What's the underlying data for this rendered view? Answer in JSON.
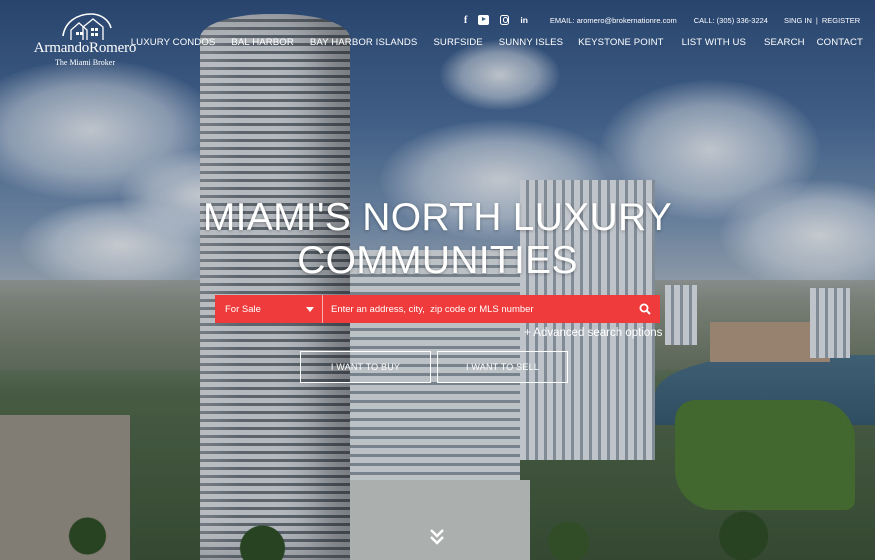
{
  "brand": {
    "name": "ArmandoRomero",
    "tagline": "The Miami Broker",
    "logo_icon": "house-roof-logo-icon"
  },
  "topbar": {
    "social": [
      "facebook-icon",
      "youtube-icon",
      "instagram-icon",
      "linkedin-icon"
    ],
    "email": "EMAIL: aromero@brokernationre.com",
    "call": "CALL: (305) 336-3224",
    "sign_in": "SING IN",
    "separator": "|",
    "register": "REGISTER"
  },
  "nav": {
    "items": [
      {
        "label": "LUXURY CONDOS"
      },
      {
        "label": "BAL HARBOR"
      },
      {
        "label": "BAY HARBOR ISLANDS"
      },
      {
        "label": "SURFSIDE"
      },
      {
        "label": "SUNNY ISLES"
      },
      {
        "label": "KEYSTONE POINT"
      },
      {
        "label": "LIST WITH US"
      },
      {
        "label": "SEARCH"
      },
      {
        "label": "CONTACT"
      }
    ]
  },
  "hero": {
    "title_line1": "MIAMI'S NORTH LUXURY",
    "title_line2": "COMMUNITIES"
  },
  "search": {
    "type_selected": "For Sale",
    "placeholder": "Enter an address, city,  zip code or MLS number",
    "button_icon": "search-icon",
    "accent_color": "#ef3b3b"
  },
  "advanced_search": "+ Advanced search options",
  "cta": {
    "buy": "I WANT TO BUY",
    "sell": "I WANT TO SELL"
  },
  "scroll_icon": "double-chevron-down-icon"
}
